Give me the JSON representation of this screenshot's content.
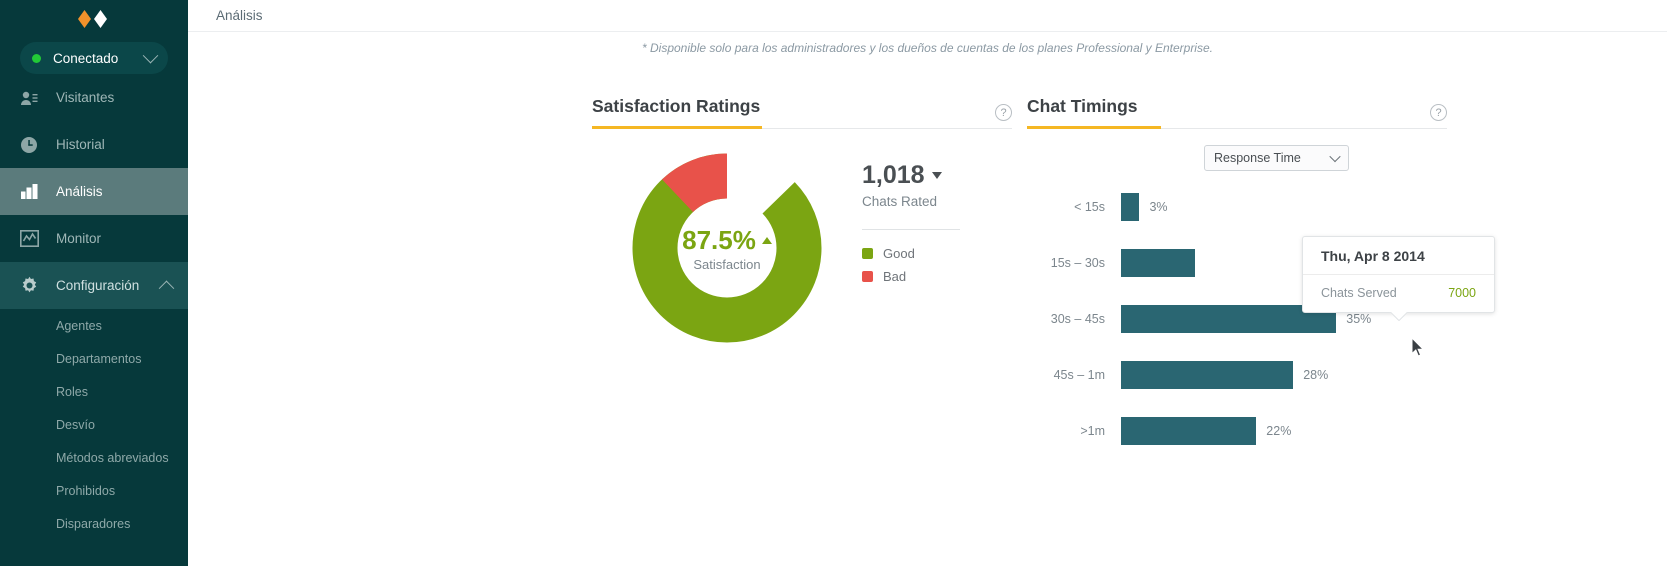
{
  "sidebar": {
    "logo": "zopim-diamond-logo",
    "status": {
      "label": "Conectado",
      "dot_color": "#22c937",
      "chevron": "chevron-down-icon"
    },
    "nav": [
      {
        "label": "Visitantes",
        "icon": "visitors-icon",
        "state": "normal"
      },
      {
        "label": "Historial",
        "icon": "clock-icon",
        "state": "normal"
      },
      {
        "label": "Análisis",
        "icon": "bar-chart-icon",
        "state": "active"
      },
      {
        "label": "Monitor",
        "icon": "monitor-icon",
        "state": "normal"
      },
      {
        "label": "Configuración",
        "icon": "gear-icon",
        "state": "expanded"
      }
    ],
    "subnav": [
      {
        "label": "Agentes"
      },
      {
        "label": "Departamentos"
      },
      {
        "label": "Roles"
      },
      {
        "label": "Desvío"
      },
      {
        "label": "Métodos abreviados"
      },
      {
        "label": "Prohibidos"
      },
      {
        "label": "Disparadores"
      }
    ]
  },
  "header": {
    "breadcrumb": "Análisis"
  },
  "disclaimer": "* Disponible solo para los administradores y los dueños de cuentas de los planes Professional y Enterprise.",
  "satisfaction": {
    "title": "Satisfaction Ratings",
    "help_icon": "question-mark-icon",
    "accent_color": "#f5b723",
    "chart_data": {
      "type": "pie",
      "title": "Satisfaction Ratings",
      "categories": [
        "Good",
        "Bad"
      ],
      "values": [
        87.5,
        12.5
      ],
      "colors": [
        "#7ba512",
        "#e8524a"
      ],
      "center_value": "87.5%",
      "center_label": "Satisfaction",
      "trend": "up",
      "legend": [
        {
          "label": "Good",
          "color": "#7ba512"
        },
        {
          "label": "Bad",
          "color": "#e8524a"
        }
      ]
    },
    "stat_value": "1,018",
    "stat_label": "Chats Rated",
    "stat_caret": "caret-down-icon"
  },
  "timings": {
    "title": "Chat Timings",
    "help_icon": "question-mark-icon",
    "accent_color": "#f5b723",
    "metric_select": {
      "value": "Response Time",
      "chevron": "chevron-down-icon"
    },
    "chart_data": {
      "type": "bar",
      "orientation": "horizontal",
      "title": "Chat Timings",
      "xlabel": "",
      "ylabel": "",
      "bar_color": "#2a6672",
      "categories": [
        "< 15s",
        "15s – 30s",
        "30s – 45s",
        "45s – 1m",
        ">1m"
      ],
      "values": [
        3,
        12,
        35,
        28,
        22
      ],
      "value_labels": [
        "3%",
        "",
        "35%",
        "28%",
        "22%"
      ],
      "xlim": [
        0,
        40
      ]
    }
  },
  "tooltip": {
    "date": "Thu, Apr 8 2014",
    "metric_label": "Chats Served",
    "metric_value": "7000",
    "value_color": "#7ba512"
  }
}
